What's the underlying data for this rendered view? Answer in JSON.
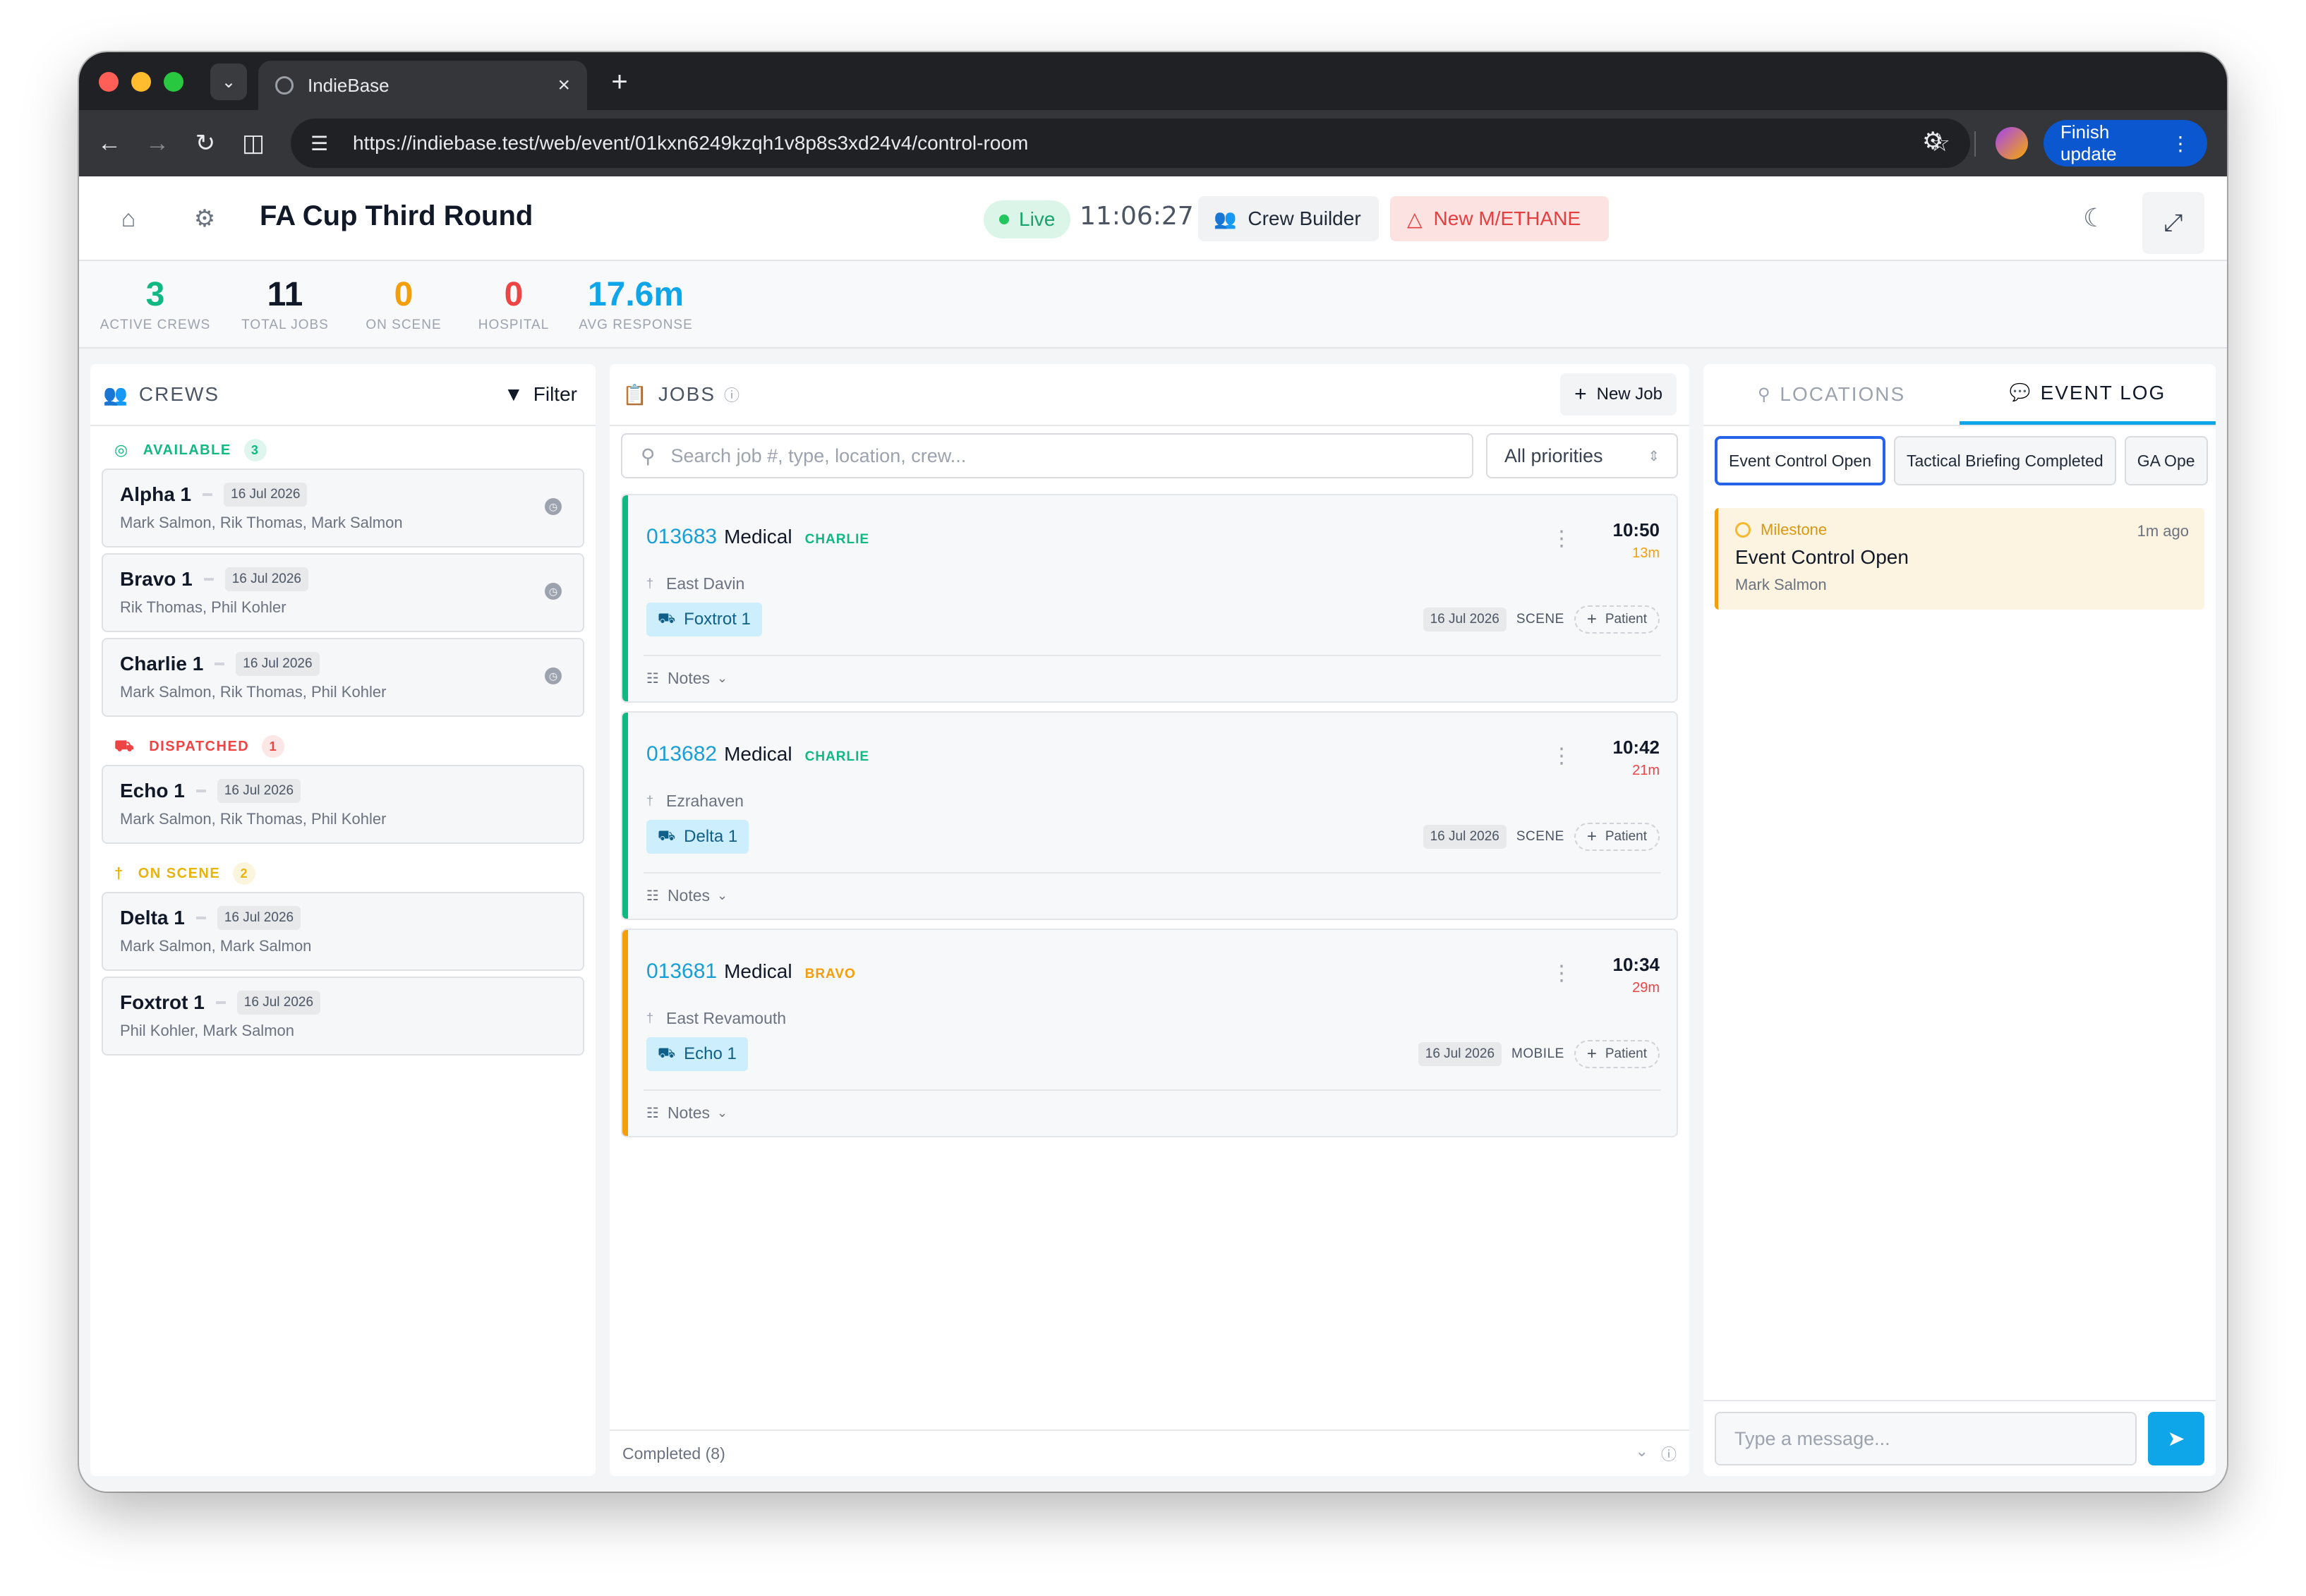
{
  "browser": {
    "tab_title": "IndieBase",
    "url": "https://indiebase.test/web/event/01kxn6249kzqh1v8p8s3xd24v4/control-room",
    "finish_update_label": "Finish update"
  },
  "header": {
    "title": "FA Cup Third Round",
    "live_label": "Live",
    "clock": "11:06:27",
    "crew_builder_label": "Crew Builder",
    "methane_label": "New M/ETHANE"
  },
  "stats": [
    {
      "value": "3",
      "label": "ACTIVE CREWS",
      "color": "#10b981"
    },
    {
      "value": "11",
      "label": "TOTAL JOBS",
      "color": "#111827"
    },
    {
      "value": "0",
      "label": "ON SCENE",
      "color": "#f59e0b"
    },
    {
      "value": "0",
      "label": "HOSPITAL",
      "color": "#ef4444"
    },
    {
      "value": "17.6m",
      "label": "AVG RESPONSE",
      "color": "#0ea5e9"
    }
  ],
  "crews": {
    "title": "CREWS",
    "filter_label": "Filter",
    "groups": [
      {
        "label": "AVAILABLE",
        "count": "3",
        "color": "#10b981",
        "icon": "check-circle-icon",
        "items": [
          {
            "name": "Alpha 1",
            "date": "16 Jul 2026",
            "members": "Mark Salmon, Rik Thomas, Mark Salmon"
          },
          {
            "name": "Bravo 1",
            "date": "16 Jul 2026",
            "members": "Rik Thomas, Phil Kohler"
          },
          {
            "name": "Charlie 1",
            "date": "16 Jul 2026",
            "members": "Mark Salmon, Rik Thomas, Phil Kohler"
          }
        ]
      },
      {
        "label": "DISPATCHED",
        "count": "1",
        "color": "#ef4444",
        "icon": "ambulance-icon",
        "items": [
          {
            "name": "Echo 1",
            "date": "16 Jul 2026",
            "members": "Mark Salmon, Rik Thomas, Phil Kohler"
          }
        ]
      },
      {
        "label": "ON SCENE",
        "count": "2",
        "color": "#eab308",
        "icon": "pin-icon",
        "items": [
          {
            "name": "Delta 1",
            "date": "16 Jul 2026",
            "members": "Mark Salmon, Mark Salmon"
          },
          {
            "name": "Foxtrot 1",
            "date": "16 Jul 2026",
            "members": "Phil Kohler, Mark Salmon"
          }
        ]
      }
    ]
  },
  "jobs": {
    "title": "JOBS",
    "new_job_label": "New Job",
    "search_placeholder": "Search job #, type, location, crew...",
    "priority_filter": "All priorities",
    "notes_label": "Notes",
    "patient_label": "Patient",
    "completed_label": "Completed (8)",
    "items": [
      {
        "number": "013683",
        "type": "Medical",
        "tag": "CHARLIE",
        "tag_color": "#10b981",
        "stripe_color": "#10b981",
        "time": "10:50",
        "ago": "13m",
        "ago_color": "#f59e0b",
        "location": "East Davin",
        "unit": "Foxtrot 1",
        "date": "16 Jul 2026",
        "status": "SCENE"
      },
      {
        "number": "013682",
        "type": "Medical",
        "tag": "CHARLIE",
        "tag_color": "#10b981",
        "stripe_color": "#10b981",
        "time": "10:42",
        "ago": "21m",
        "ago_color": "#ef4444",
        "location": "Ezrahaven",
        "unit": "Delta 1",
        "date": "16 Jul 2026",
        "status": "SCENE"
      },
      {
        "number": "013681",
        "type": "Medical",
        "tag": "BRAVO",
        "tag_color": "#f59e0b",
        "stripe_color": "#f59e0b",
        "time": "10:34",
        "ago": "29m",
        "ago_color": "#ef4444",
        "location": "East Revamouth",
        "unit": "Echo 1",
        "date": "16 Jul 2026",
        "status": "MOBILE"
      }
    ]
  },
  "log": {
    "tab_locations": "LOCATIONS",
    "tab_event_log": "EVENT LOG",
    "chips": [
      "Event Control Open",
      "Tactical Briefing Completed",
      "GA Ope"
    ],
    "entries": [
      {
        "kind": "Milestone",
        "ago": "1m ago",
        "title": "Event Control Open",
        "author": "Mark Salmon"
      }
    ],
    "message_placeholder": "Type a message..."
  }
}
